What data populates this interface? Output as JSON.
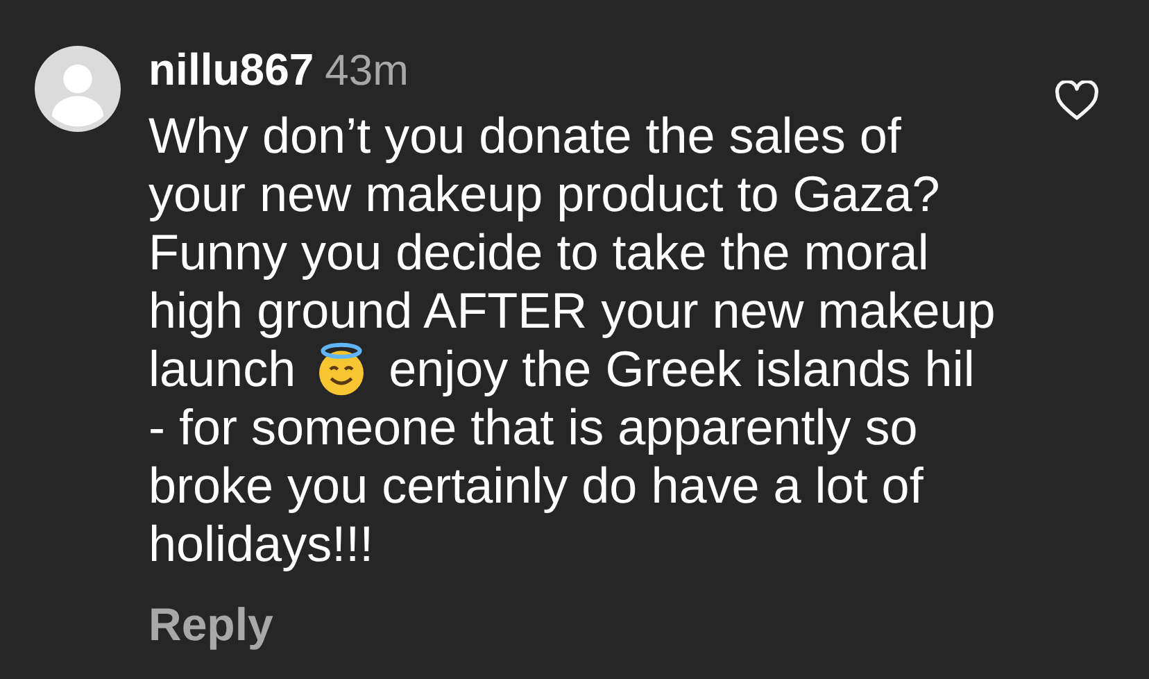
{
  "comment": {
    "username": "nillu867",
    "time": "43m",
    "text_lines_1_to_4": "Why don’t you donate the sales of\nyour new makeup product to Gaza?\nFunny you decide to take the moral\nhigh ground AFTER your new makeup",
    "text_before_emoji": "launch",
    "text_after_emoji": "enjoy the Greek islands hil",
    "text_last_lines": "- for someone that is apparently so\nbroke you certainly do have a lot of\nholidays!!!",
    "liked": false,
    "reply": "Reply"
  }
}
